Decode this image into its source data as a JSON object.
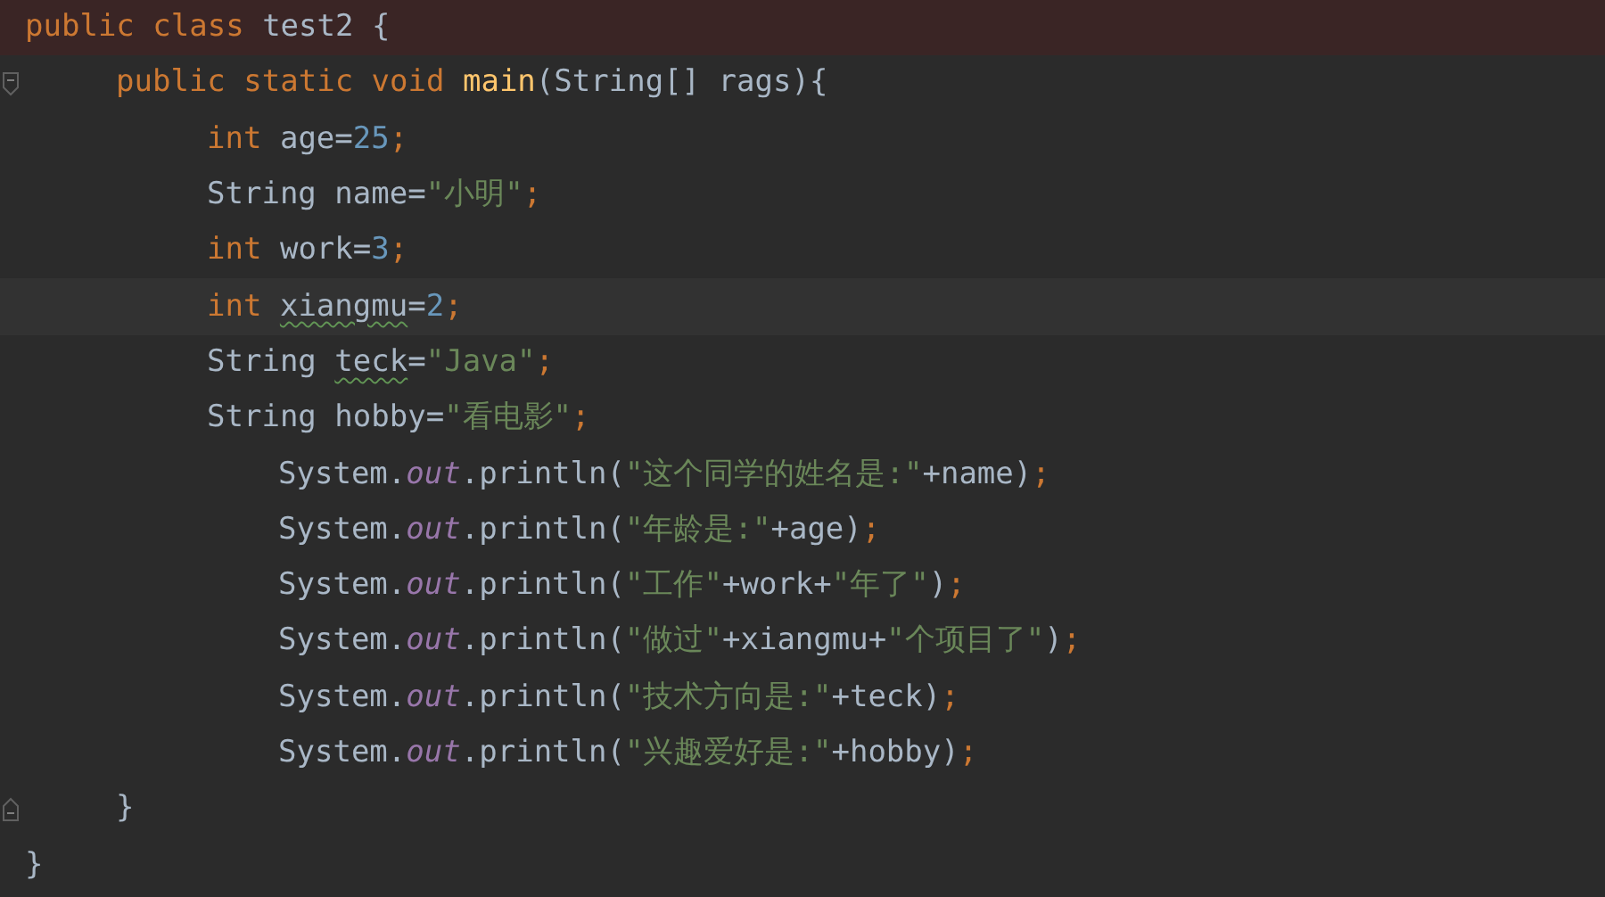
{
  "editor": {
    "lines": [
      {
        "error_highlight": true,
        "tokens": [
          {
            "text": "public class ",
            "kind": "keyword"
          },
          {
            "text": "test2 {",
            "kind": "plain"
          }
        ],
        "children": [
          {
            "fold_open": true,
            "tokens": [
              {
                "text": "public static void ",
                "kind": "keyword"
              },
              {
                "text": "main",
                "kind": "method"
              },
              {
                "text": "(String[] rags){",
                "kind": "plain"
              }
            ],
            "children": [
              {
                "tokens": [
                  {
                    "text": "int ",
                    "kind": "keyword"
                  },
                  {
                    "text": "age=",
                    "kind": "plain"
                  },
                  {
                    "text": "25",
                    "kind": "number"
                  },
                  {
                    "text": ";",
                    "kind": "keyword"
                  }
                ]
              },
              {
                "tokens": [
                  {
                    "text": "String name=",
                    "kind": "plain"
                  },
                  {
                    "text": "\"小明\"",
                    "kind": "string"
                  },
                  {
                    "text": ";",
                    "kind": "keyword"
                  }
                ]
              },
              {
                "tokens": [
                  {
                    "text": "int ",
                    "kind": "keyword"
                  },
                  {
                    "text": "work=",
                    "kind": "plain"
                  },
                  {
                    "text": "3",
                    "kind": "number"
                  },
                  {
                    "text": ";",
                    "kind": "keyword"
                  }
                ]
              },
              {
                "caret_line": true,
                "tokens": [
                  {
                    "text": "int ",
                    "kind": "keyword"
                  },
                  {
                    "text": "xiangmu",
                    "kind": "plain",
                    "warning": true
                  },
                  {
                    "text": "=",
                    "kind": "plain"
                  },
                  {
                    "text": "2",
                    "kind": "number"
                  },
                  {
                    "text": ";",
                    "kind": "keyword"
                  }
                ]
              },
              {
                "tokens": [
                  {
                    "text": "String ",
                    "kind": "plain"
                  },
                  {
                    "text": "teck",
                    "kind": "plain",
                    "warning": true
                  },
                  {
                    "text": "=",
                    "kind": "plain"
                  },
                  {
                    "text": "\"Java\"",
                    "kind": "string"
                  },
                  {
                    "text": ";",
                    "kind": "keyword"
                  }
                ]
              },
              {
                "tokens": [
                  {
                    "text": "String hobby=",
                    "kind": "plain"
                  },
                  {
                    "text": "\"看电影\"",
                    "kind": "string"
                  },
                  {
                    "text": ";",
                    "kind": "keyword"
                  }
                ],
                "children": [
                  {
                    "tokens": [
                      {
                        "text": "System.",
                        "kind": "plain"
                      },
                      {
                        "text": "out",
                        "kind": "field"
                      },
                      {
                        "text": ".println(",
                        "kind": "plain"
                      },
                      {
                        "text": "\"这个同学的姓名是:\"",
                        "kind": "string"
                      },
                      {
                        "text": "+name)",
                        "kind": "plain"
                      },
                      {
                        "text": ";",
                        "kind": "keyword"
                      }
                    ]
                  },
                  {
                    "tokens": [
                      {
                        "text": "System.",
                        "kind": "plain"
                      },
                      {
                        "text": "out",
                        "kind": "field"
                      },
                      {
                        "text": ".println(",
                        "kind": "plain"
                      },
                      {
                        "text": "\"年龄是:\"",
                        "kind": "string"
                      },
                      {
                        "text": "+age)",
                        "kind": "plain"
                      },
                      {
                        "text": ";",
                        "kind": "keyword"
                      }
                    ]
                  },
                  {
                    "tokens": [
                      {
                        "text": "System.",
                        "kind": "plain"
                      },
                      {
                        "text": "out",
                        "kind": "field"
                      },
                      {
                        "text": ".println(",
                        "kind": "plain"
                      },
                      {
                        "text": "\"工作\"",
                        "kind": "string"
                      },
                      {
                        "text": "+work+",
                        "kind": "plain"
                      },
                      {
                        "text": "\"年了\"",
                        "kind": "string"
                      },
                      {
                        "text": ")",
                        "kind": "plain"
                      },
                      {
                        "text": ";",
                        "kind": "keyword"
                      }
                    ]
                  },
                  {
                    "tokens": [
                      {
                        "text": "System.",
                        "kind": "plain"
                      },
                      {
                        "text": "out",
                        "kind": "field"
                      },
                      {
                        "text": ".println(",
                        "kind": "plain"
                      },
                      {
                        "text": "\"做过\"",
                        "kind": "string"
                      },
                      {
                        "text": "+xiangmu+",
                        "kind": "plain"
                      },
                      {
                        "text": "\"个项目了\"",
                        "kind": "string"
                      },
                      {
                        "text": ")",
                        "kind": "plain"
                      },
                      {
                        "text": ";",
                        "kind": "keyword"
                      }
                    ]
                  },
                  {
                    "tokens": [
                      {
                        "text": "System.",
                        "kind": "plain"
                      },
                      {
                        "text": "out",
                        "kind": "field"
                      },
                      {
                        "text": ".println(",
                        "kind": "plain"
                      },
                      {
                        "text": "\"技术方向是:\"",
                        "kind": "string"
                      },
                      {
                        "text": "+teck)",
                        "kind": "plain"
                      },
                      {
                        "text": ";",
                        "kind": "keyword"
                      }
                    ]
                  },
                  {
                    "tokens": [
                      {
                        "text": "System.",
                        "kind": "plain"
                      },
                      {
                        "text": "out",
                        "kind": "field"
                      },
                      {
                        "text": ".println(",
                        "kind": "plain"
                      },
                      {
                        "text": "\"兴趣爱好是:\"",
                        "kind": "string"
                      },
                      {
                        "text": "+hobby)",
                        "kind": "plain"
                      },
                      {
                        "text": ";",
                        "kind": "keyword"
                      }
                    ]
                  }
                ]
              }
            ]
          },
          {
            "fold_close": true,
            "tokens": [
              {
                "text": "}",
                "kind": "plain"
              }
            ]
          }
        ]
      },
      {
        "tokens": [
          {
            "text": "}",
            "kind": "plain"
          }
        ]
      }
    ]
  }
}
